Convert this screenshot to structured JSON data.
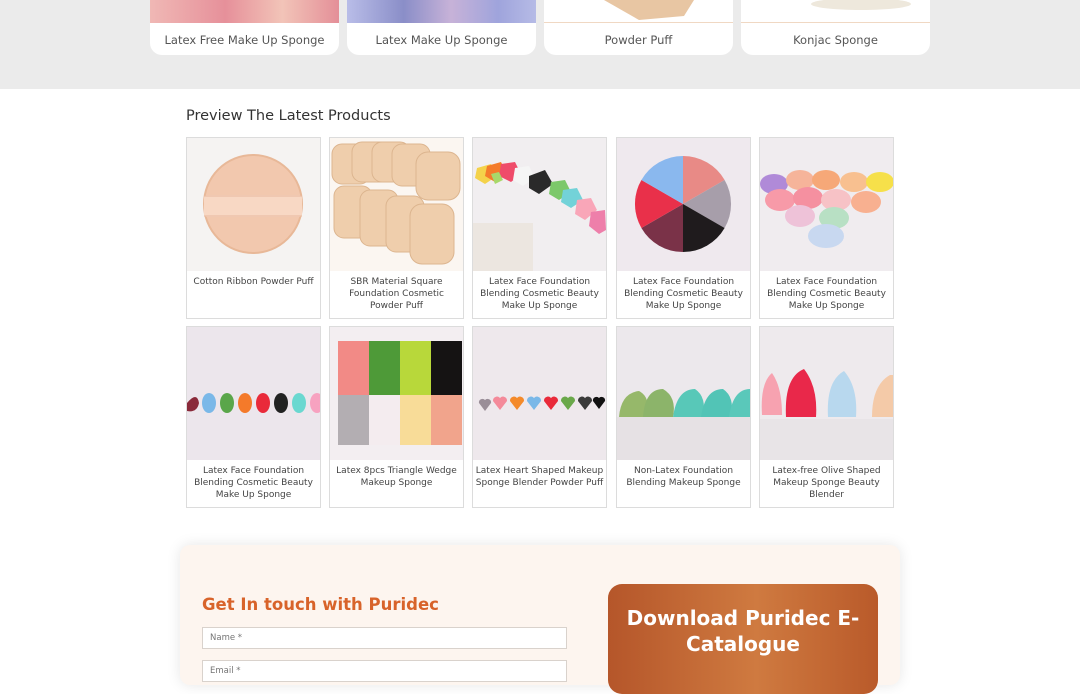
{
  "categories": [
    {
      "label": "Latex Free Make Up Sponge",
      "color": "#e49a9a"
    },
    {
      "label": "Latex Make Up Sponge",
      "color": "#a3a8d8"
    },
    {
      "label": "Powder Puff",
      "color": "#e9c7a5"
    },
    {
      "label": "Konjac Sponge",
      "color": "#eae5da"
    }
  ],
  "latest": {
    "title": "Preview The Latest Products",
    "products": [
      {
        "name": "Cotton Ribbon Powder Puff",
        "icon": "round-puff"
      },
      {
        "name": "SBR Material Square Foundation Cosmetic Powder Puff",
        "icon": "square-puffs"
      },
      {
        "name": "Latex Face Foundation Blending Cosmetic Beauty Make Up Sponge",
        "icon": "hexagon-sponges"
      },
      {
        "name": "Latex Face Foundation Blending Cosmetic Beauty Make Up Sponge",
        "icon": "wheel-sponge"
      },
      {
        "name": "Latex Face Foundation Blending Cosmetic Beauty Make Up Sponge",
        "icon": "lip-sponges"
      },
      {
        "name": "Latex Face Foundation Blending Cosmetic Beauty Make Up Sponge",
        "icon": "teardrop-sponges"
      },
      {
        "name": "Latex 8pcs Triangle Wedge Makeup Sponge",
        "icon": "wedge-sponges"
      },
      {
        "name": "Latex Heart Shaped Makeup Sponge Blender Powder Puff",
        "icon": "heart-sponges"
      },
      {
        "name": "Non-Latex Foundation Blending Makeup Sponge",
        "icon": "cut-sponges"
      },
      {
        "name": "Latex-free Olive Shaped Makeup Sponge Beauty Blender",
        "icon": "olive-sponges"
      }
    ]
  },
  "contact": {
    "title": "Get In touch with Puridec",
    "name_placeholder": "Name *",
    "email_placeholder": "Email *"
  },
  "download": {
    "title": "Download Puridec E-Catalogue"
  },
  "colors": {
    "accent": "#d8632a",
    "band": "#ebebeb"
  }
}
